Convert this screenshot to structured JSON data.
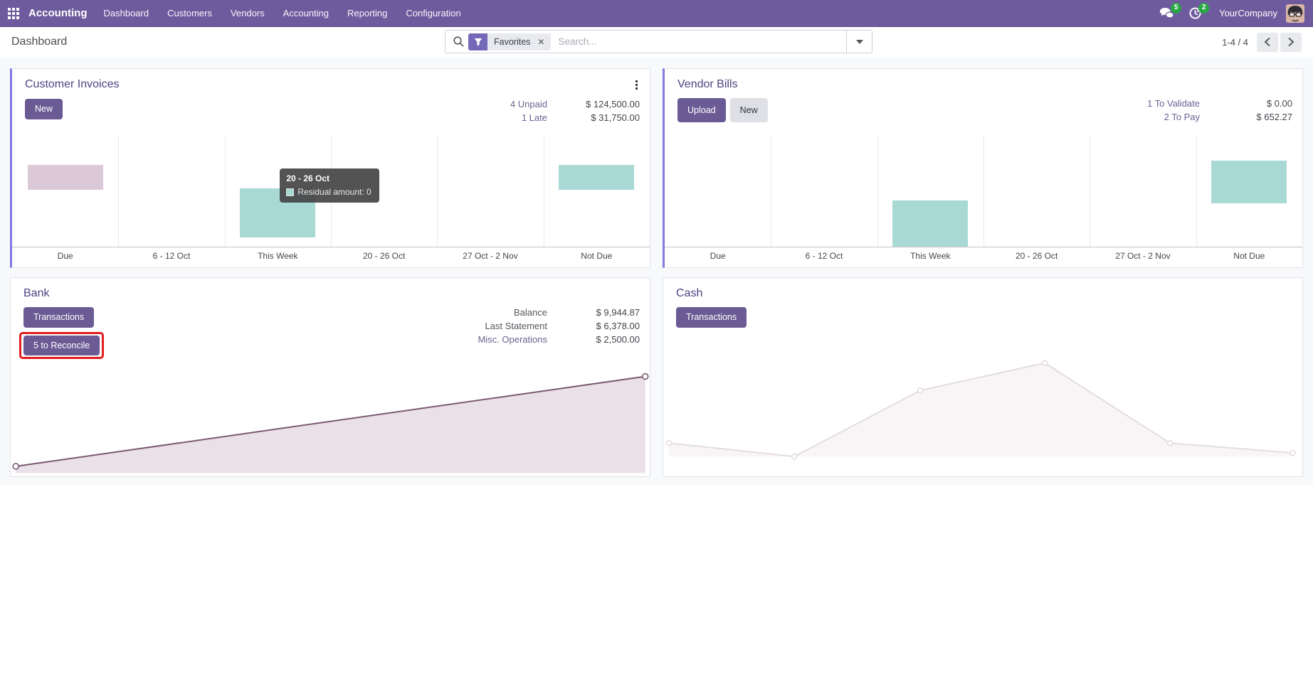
{
  "navbar": {
    "app_name": "Accounting",
    "menu": [
      "Dashboard",
      "Customers",
      "Vendors",
      "Accounting",
      "Reporting",
      "Configuration"
    ],
    "messages_badge": "5",
    "activities_badge": "2",
    "company_name": "YourCompany"
  },
  "control_panel": {
    "title": "Dashboard",
    "search": {
      "facet": "Favorites",
      "placeholder": "Search..."
    },
    "pager": {
      "range": "1-4 / 4"
    }
  },
  "cards": {
    "customer_invoices": {
      "title": "Customer Invoices",
      "new_button": "New",
      "stats": [
        {
          "label": "4 Unpaid",
          "value": "$ 124,500.00"
        },
        {
          "label": "1 Late",
          "value": "$ 31,750.00"
        }
      ]
    },
    "vendor_bills": {
      "title": "Vendor Bills",
      "upload_button": "Upload",
      "new_button": "New",
      "stats": [
        {
          "label": "1 To Validate",
          "value": "$ 0.00"
        },
        {
          "label": "2 To Pay",
          "value": "$ 652.27"
        }
      ]
    },
    "bank": {
      "title": "Bank",
      "transactions_button": "Transactions",
      "reconcile_button": "5 to Reconcile",
      "stats": [
        {
          "label": "Balance",
          "value": "$ 9,944.87"
        },
        {
          "label": "Last Statement",
          "value": "$ 6,378.00"
        },
        {
          "label": "Misc. Operations",
          "value": "$ 2,500.00"
        }
      ]
    },
    "cash": {
      "title": "Cash",
      "transactions_button": "Transactions"
    }
  },
  "chart_data": [
    {
      "id": "customer-invoices-chart",
      "type": "bar",
      "categories": [
        "Due",
        "6 - 12 Oct",
        "This Week",
        "20 - 26 Oct",
        "27 Oct - 2 Nov",
        "Not Due"
      ],
      "series": [
        {
          "name": "overdue",
          "color": "#dbc9d8",
          "bars": [
            {
              "category": "Due",
              "y0": 0.27,
              "y1": 0.49
            }
          ]
        },
        {
          "name": "expected",
          "color": "#a9d9d5",
          "bars": [
            {
              "category": "This Week",
              "y0": 0.475,
              "y1": 0.92
            },
            {
              "category": "Not Due",
              "y0": 0.27,
              "y1": 0.49
            }
          ]
        }
      ],
      "tooltip": {
        "title": "20 - 26 Oct",
        "label": "Residual amount: 0",
        "swatch_color": "#a9d9d5"
      }
    },
    {
      "id": "vendor-bills-chart",
      "type": "bar",
      "categories": [
        "Due",
        "6 - 12 Oct",
        "This Week",
        "20 - 26 Oct",
        "27 Oct - 2 Nov",
        "Not Due"
      ],
      "series": [
        {
          "name": "expected",
          "color": "#a9d9d5",
          "bars": [
            {
              "category": "This Week",
              "y0": 0.585,
              "y1": 1.0
            },
            {
              "category": "Not Due",
              "y0": 0.23,
              "y1": 0.61
            }
          ]
        }
      ]
    },
    {
      "id": "bank-chart",
      "type": "area",
      "line_color": "#7b5a72",
      "fill_color": "#eae0e7",
      "marker_radius": 4,
      "baseline": 0.985,
      "points": [
        {
          "x": 0.008,
          "y": 0.93
        },
        {
          "x": 0.993,
          "y": 0.195
        }
      ]
    },
    {
      "id": "cash-chart",
      "type": "area",
      "line_color": "#e4dce1",
      "fill_color": "#f8f5f7",
      "marker_radius": 3.5,
      "baseline": 0.85,
      "points": [
        {
          "x": 0.009,
          "y": 0.74
        },
        {
          "x": 0.205,
          "y": 0.85
        },
        {
          "x": 0.402,
          "y": 0.31
        },
        {
          "x": 0.597,
          "y": 0.085
        },
        {
          "x": 0.793,
          "y": 0.74
        },
        {
          "x": 0.985,
          "y": 0.82
        }
      ]
    }
  ],
  "colors": {
    "navbar": "#6d5b9e",
    "primary_button": "#6b5b95",
    "card_accent_border": "#8478e2",
    "badge_green": "#28a745",
    "teal_bar": "#a9d9d5",
    "pink_bar": "#dbc9d8",
    "annotation_red": "#e21d1d"
  }
}
